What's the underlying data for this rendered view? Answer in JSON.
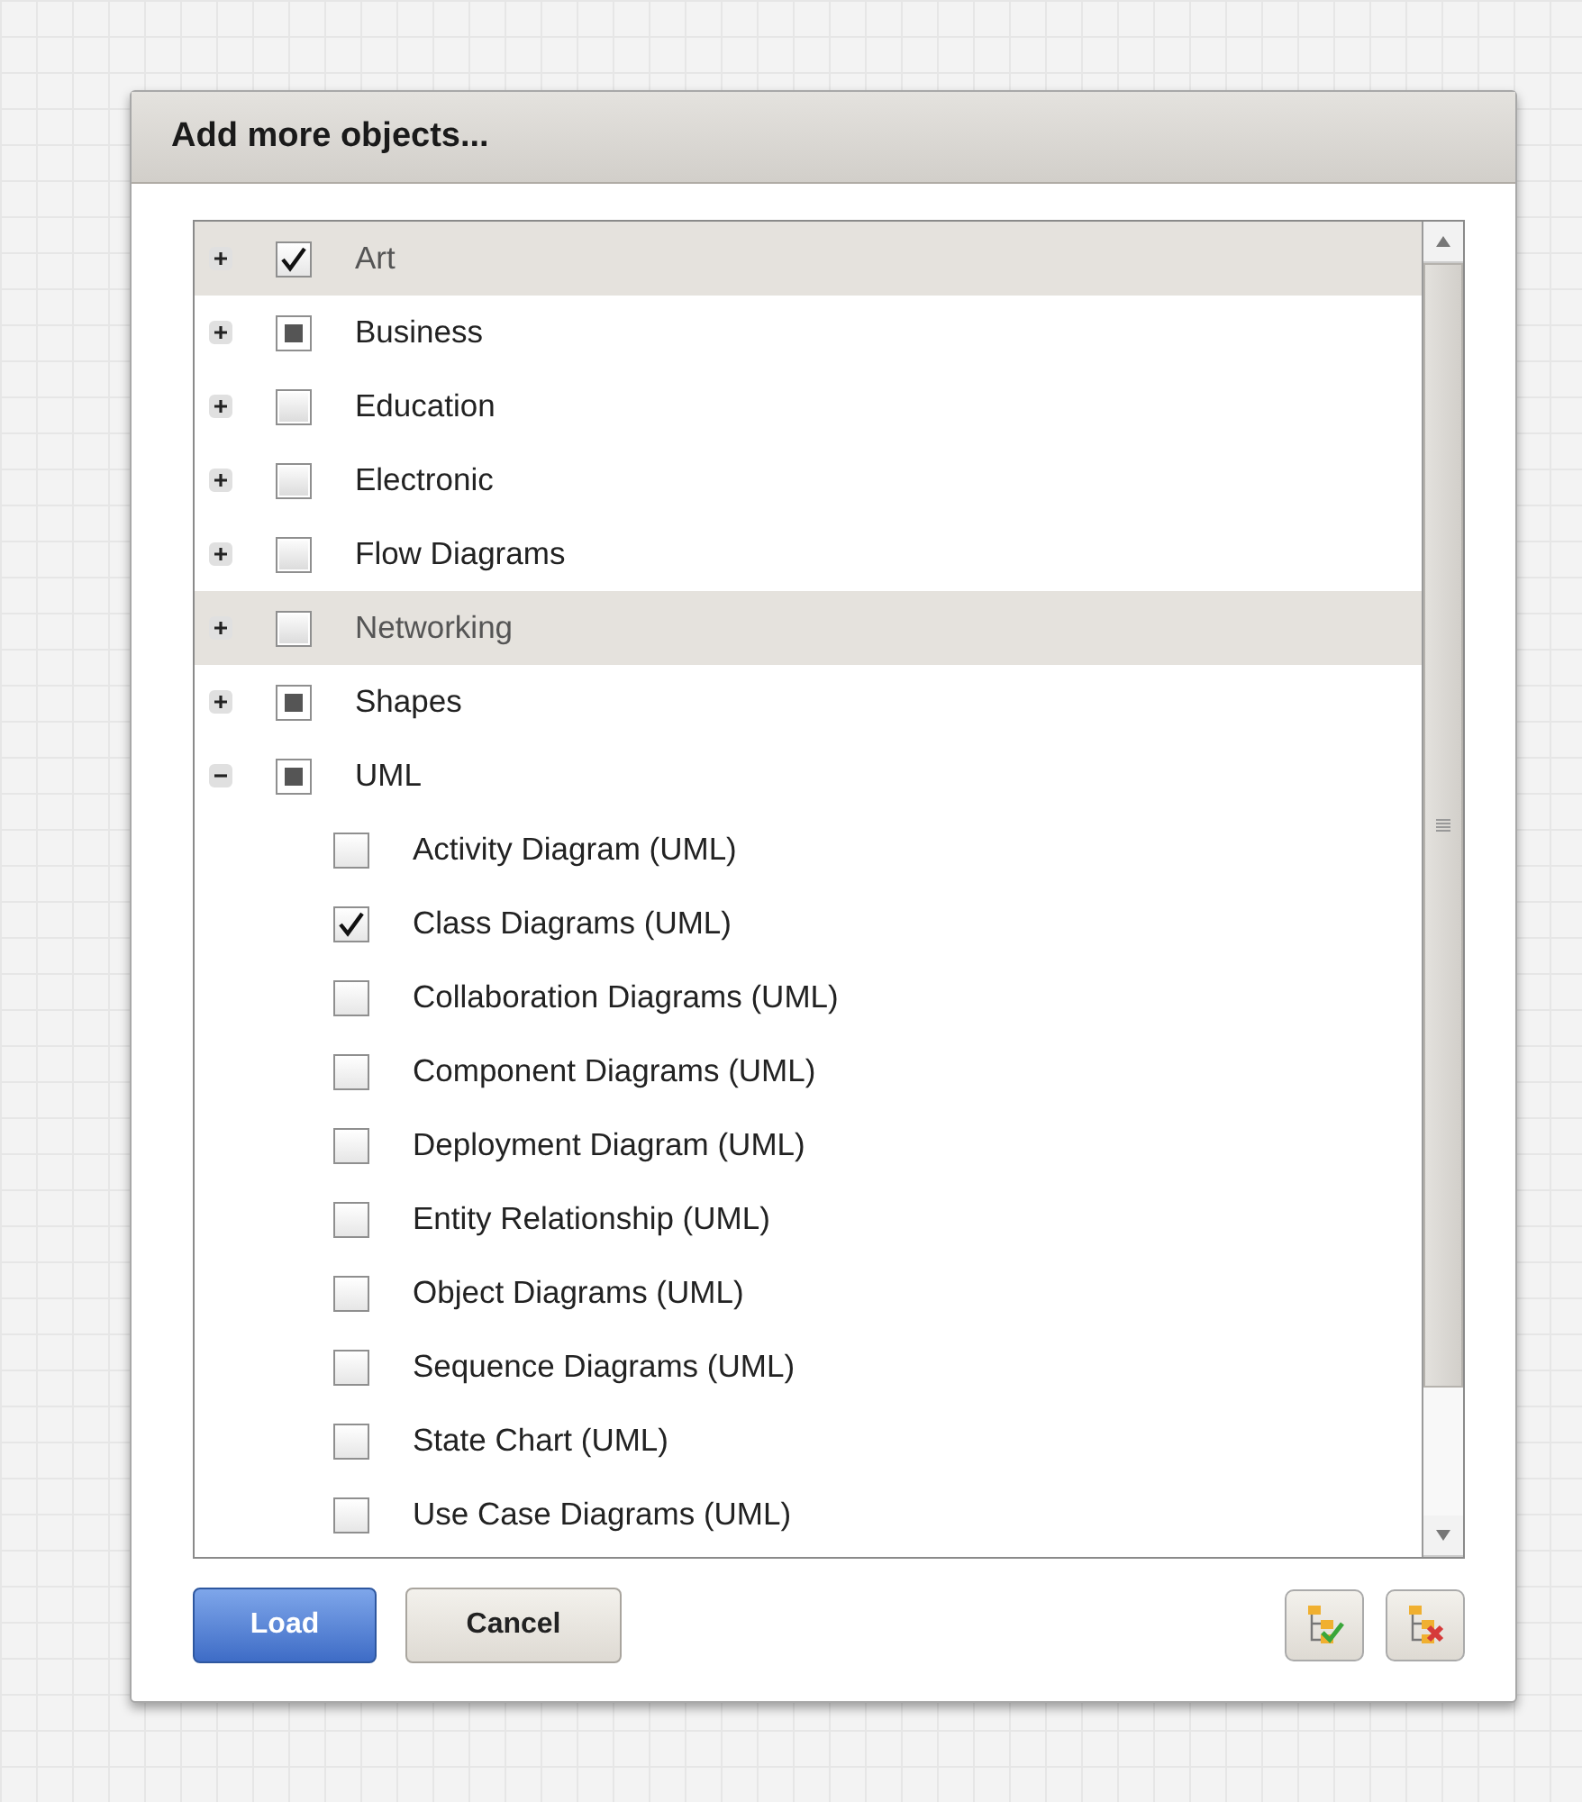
{
  "dialog": {
    "title": "Add more objects..."
  },
  "tree": [
    {
      "label": "Art",
      "expanded": false,
      "checked": true,
      "highlighted": true
    },
    {
      "label": "Business",
      "expanded": false,
      "checked": false,
      "partial": true,
      "highlighted": false
    },
    {
      "label": "Education",
      "expanded": false,
      "checked": false,
      "partial": false,
      "highlighted": false
    },
    {
      "label": "Electronic",
      "expanded": false,
      "checked": false,
      "partial": false,
      "highlighted": false
    },
    {
      "label": "Flow Diagrams",
      "expanded": false,
      "checked": false,
      "partial": false,
      "highlighted": false
    },
    {
      "label": "Networking",
      "expanded": false,
      "checked": false,
      "partial": false,
      "highlighted": true
    },
    {
      "label": "Shapes",
      "expanded": false,
      "checked": false,
      "partial": true,
      "highlighted": false
    },
    {
      "label": "UML",
      "expanded": true,
      "checked": false,
      "partial": true,
      "highlighted": false,
      "children": [
        {
          "label": "Activity Diagram (UML)",
          "checked": false
        },
        {
          "label": "Class Diagrams (UML)",
          "checked": true
        },
        {
          "label": "Collaboration Diagrams (UML)",
          "checked": false
        },
        {
          "label": "Component Diagrams (UML)",
          "checked": false
        },
        {
          "label": "Deployment Diagram (UML)",
          "checked": false
        },
        {
          "label": "Entity Relationship (UML)",
          "checked": false
        },
        {
          "label": "Object Diagrams (UML)",
          "checked": false
        },
        {
          "label": "Sequence Diagrams (UML)",
          "checked": false
        },
        {
          "label": "State Chart (UML)",
          "checked": false
        },
        {
          "label": "Use Case Diagrams (UML)",
          "checked": false
        }
      ]
    }
  ],
  "buttons": [
    {
      "label": "Load",
      "kind": "primary"
    },
    {
      "label": "Cancel",
      "kind": "secondary"
    }
  ],
  "icon_buttons": [
    {
      "kind": "select-all"
    },
    {
      "kind": "clear-all"
    }
  ]
}
